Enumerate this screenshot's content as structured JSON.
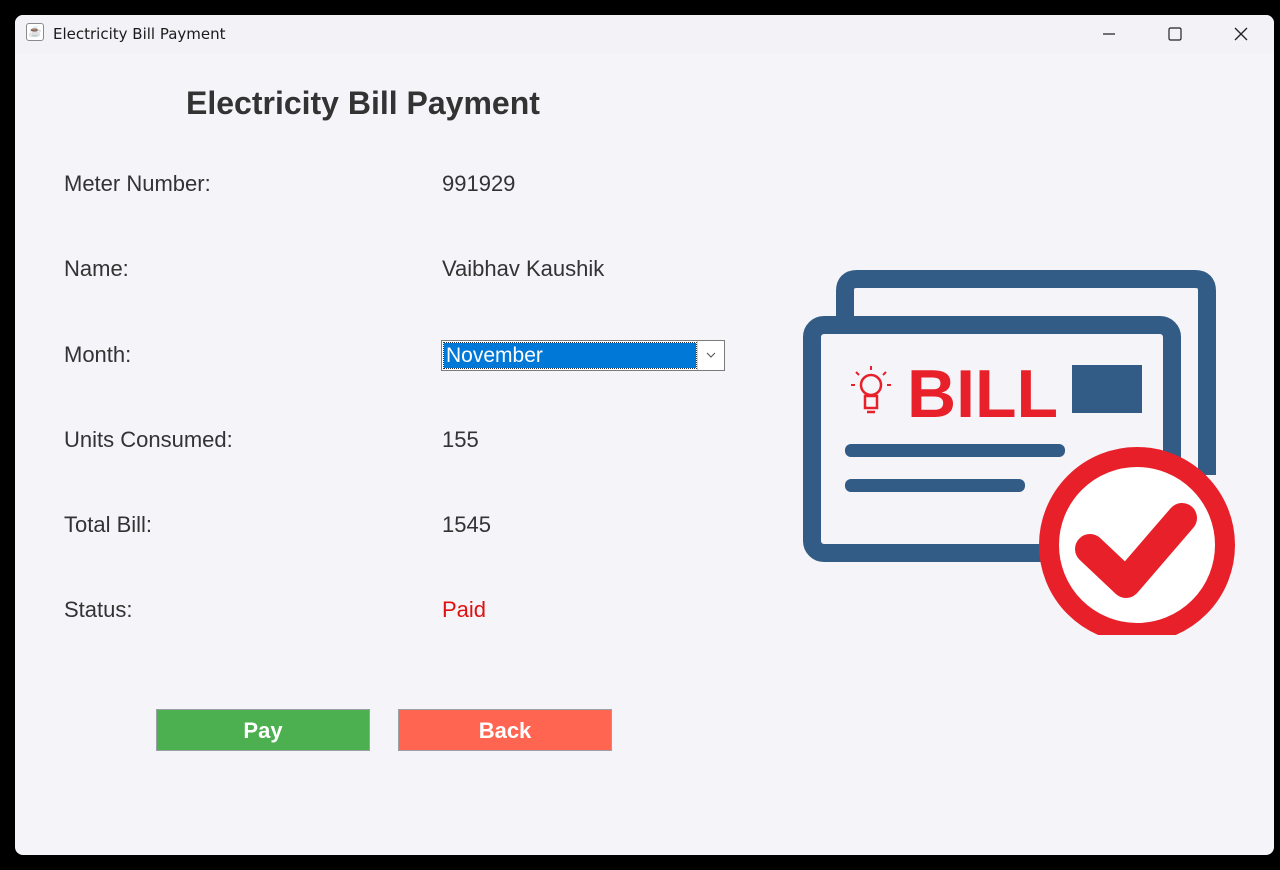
{
  "window": {
    "title": "Electricity Bill Payment"
  },
  "heading": "Electricity Bill Payment",
  "fields": {
    "meter_number": {
      "label": "Meter Number:",
      "value": "991929"
    },
    "name": {
      "label": "Name:",
      "value": "Vaibhav Kaushik"
    },
    "month": {
      "label": "Month:",
      "selected": "November"
    },
    "units": {
      "label": "Units Consumed:",
      "value": "155"
    },
    "total": {
      "label": "Total Bill:",
      "value": "1545"
    },
    "status": {
      "label": "Status:",
      "value": "Paid"
    }
  },
  "buttons": {
    "pay": "Pay",
    "back": "Back"
  },
  "illustration": {
    "text": "BILL",
    "icons": [
      "bill-document-icon",
      "lightbulb-icon",
      "checkmark-circle-icon"
    ]
  },
  "colors": {
    "status_paid": "#e01010",
    "pay_button": "#4caf50",
    "back_button": "#ff6550",
    "selection": "#0078d7",
    "bill_blue": "#325c85",
    "bill_red": "#e8202a"
  }
}
